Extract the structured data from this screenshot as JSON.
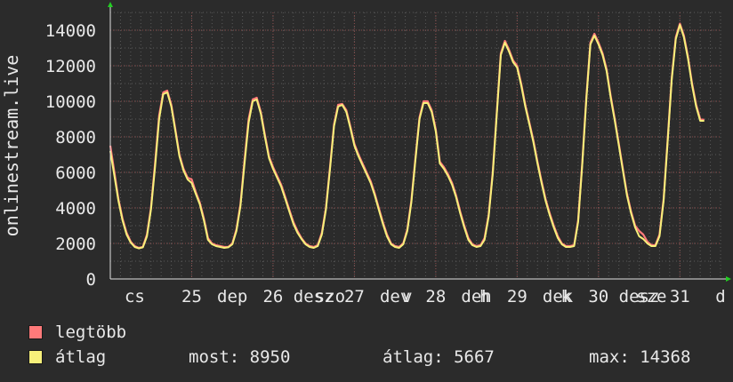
{
  "chart_data": {
    "type": "line",
    "ylabel": "onlinestream.live",
    "ylim": [
      0,
      15000
    ],
    "yticks": [
      0,
      2000,
      4000,
      6000,
      8000,
      10000,
      12000,
      14000
    ],
    "xtick_labels": [
      {
        "pos": 0.3,
        "text": "cs"
      },
      {
        "pos": 1,
        "text": "25"
      },
      {
        "pos": 1.5,
        "text": "dep"
      },
      {
        "pos": 2,
        "text": "26"
      },
      {
        "pos": 2.5,
        "text": "desz"
      },
      {
        "pos": 2.7,
        "text": "szo"
      },
      {
        "pos": 3,
        "text": "27"
      },
      {
        "pos": 3.5,
        "text": "dev"
      },
      {
        "pos": 3.65,
        "text": "v"
      },
      {
        "pos": 4,
        "text": "28"
      },
      {
        "pos": 4.5,
        "text": "deh"
      },
      {
        "pos": 4.6,
        "text": "h"
      },
      {
        "pos": 5,
        "text": "29"
      },
      {
        "pos": 5.5,
        "text": "dek"
      },
      {
        "pos": 5.6,
        "text": "k"
      },
      {
        "pos": 6,
        "text": "30"
      },
      {
        "pos": 6.5,
        "text": "desz"
      },
      {
        "pos": 6.65,
        "text": "sze"
      },
      {
        "pos": 7,
        "text": "31"
      },
      {
        "pos": 7.5,
        "text": "d"
      }
    ],
    "grid": true,
    "x": [
      0,
      0.05,
      0.1,
      0.15,
      0.2,
      0.25,
      0.3,
      0.35,
      0.4,
      0.45,
      0.5,
      0.55,
      0.6,
      0.65,
      0.7,
      0.75,
      0.8,
      0.85,
      0.9,
      0.95,
      1.0,
      1.05,
      1.1,
      1.15,
      1.2,
      1.25,
      1.3,
      1.35,
      1.4,
      1.45,
      1.5,
      1.55,
      1.6,
      1.65,
      1.7,
      1.75,
      1.8,
      1.85,
      1.9,
      1.95,
      2.0,
      2.05,
      2.1,
      2.15,
      2.2,
      2.25,
      2.3,
      2.35,
      2.4,
      2.45,
      2.5,
      2.55,
      2.6,
      2.65,
      2.7,
      2.75,
      2.8,
      2.85,
      2.9,
      2.95,
      3.0,
      3.05,
      3.1,
      3.15,
      3.2,
      3.25,
      3.3,
      3.35,
      3.4,
      3.45,
      3.5,
      3.55,
      3.6,
      3.65,
      3.7,
      3.75,
      3.8,
      3.85,
      3.9,
      3.95,
      4.0,
      4.05,
      4.1,
      4.15,
      4.2,
      4.25,
      4.3,
      4.35,
      4.4,
      4.45,
      4.5,
      4.55,
      4.6,
      4.65,
      4.7,
      4.75,
      4.8,
      4.85,
      4.9,
      4.95,
      5.0,
      5.05,
      5.1,
      5.15,
      5.2,
      5.25,
      5.3,
      5.35,
      5.4,
      5.45,
      5.5,
      5.55,
      5.6,
      5.65,
      5.7,
      5.75,
      5.8,
      5.85,
      5.9,
      5.95,
      6.0,
      6.05,
      6.1,
      6.15,
      6.2,
      6.25,
      6.3,
      6.35,
      6.4,
      6.45,
      6.5,
      6.55,
      6.6,
      6.65,
      6.7,
      6.75,
      6.8,
      6.85,
      6.9,
      6.95,
      7.0,
      7.05,
      7.1,
      7.15,
      7.2,
      7.25,
      7.3,
      7.35,
      7.4,
      7.45,
      7.5
    ],
    "series": [
      {
        "name": "legtöbb",
        "color": "#ff7a7a",
        "values": [
          7500,
          6000,
          4500,
          3400,
          2600,
          2100,
          1850,
          1750,
          1800,
          2500,
          4000,
          6500,
          9200,
          10500,
          10600,
          9800,
          8400,
          7000,
          6200,
          5700,
          5600,
          4900,
          4300,
          3400,
          2300,
          2000,
          1900,
          1850,
          1800,
          1800,
          2000,
          2800,
          4200,
          6700,
          9000,
          10100,
          10200,
          9400,
          8100,
          6900,
          6300,
          5800,
          5300,
          4600,
          3900,
          3200,
          2700,
          2300,
          2000,
          1850,
          1800,
          1900,
          2600,
          4000,
          6300,
          8700,
          9800,
          9850,
          9500,
          8600,
          7600,
          7000,
          6500,
          6000,
          5500,
          4800,
          4000,
          3200,
          2500,
          2000,
          1850,
          1800,
          2000,
          2800,
          4400,
          6800,
          9100,
          10000,
          10000,
          9500,
          8400,
          6600,
          6300,
          5900,
          5400,
          4700,
          3800,
          3000,
          2300,
          1950,
          1850,
          1900,
          2300,
          3600,
          6000,
          9400,
          12700,
          13400,
          12900,
          12300,
          12000,
          11000,
          9800,
          8800,
          7800,
          6600,
          5500,
          4500,
          3700,
          3000,
          2400,
          2000,
          1850,
          1850,
          1900,
          3300,
          6500,
          10200,
          13300,
          13800,
          13300,
          12700,
          11800,
          10300,
          9000,
          7600,
          6200,
          4800,
          3800,
          3000,
          2700,
          2500,
          2100,
          1900,
          1900,
          2500,
          4500,
          7800,
          11300,
          13600,
          14368,
          13700,
          12500,
          11000,
          9800,
          9000,
          8950
        ]
      },
      {
        "name": "átlag",
        "color": "#f7f07a",
        "values": [
          7200,
          5800,
          4400,
          3300,
          2500,
          2050,
          1800,
          1720,
          1780,
          2400,
          3900,
          6300,
          9000,
          10400,
          10500,
          9700,
          8300,
          6900,
          6100,
          5600,
          5400,
          4800,
          4200,
          3300,
          2200,
          1950,
          1850,
          1800,
          1750,
          1780,
          1950,
          2700,
          4100,
          6500,
          8800,
          10000,
          10100,
          9300,
          8000,
          6800,
          6200,
          5700,
          5200,
          4500,
          3800,
          3100,
          2600,
          2250,
          1950,
          1800,
          1750,
          1850,
          2500,
          3900,
          6200,
          8600,
          9700,
          9800,
          9400,
          8500,
          7500,
          6900,
          6400,
          5900,
          5400,
          4700,
          3900,
          3100,
          2400,
          1950,
          1800,
          1750,
          1950,
          2700,
          4300,
          6700,
          9000,
          9900,
          9900,
          9400,
          8300,
          6500,
          6200,
          5800,
          5300,
          4600,
          3700,
          2900,
          2200,
          1900,
          1800,
          1850,
          2200,
          3500,
          5900,
          9300,
          12600,
          13300,
          12800,
          12200,
          11900,
          10900,
          9700,
          8700,
          7700,
          6500,
          5400,
          4400,
          3600,
          2900,
          2300,
          1950,
          1800,
          1800,
          1850,
          3200,
          6400,
          10100,
          13200,
          13700,
          13200,
          12600,
          11700,
          10200,
          8900,
          7500,
          6100,
          4700,
          3700,
          2900,
          2400,
          2250,
          2000,
          1850,
          1850,
          2400,
          4400,
          7700,
          11200,
          13500,
          14300,
          13600,
          12400,
          10900,
          9700,
          8900,
          8900
        ]
      }
    ]
  },
  "legend": [
    {
      "label": "legtöbb",
      "color": "#ff7a7a"
    },
    {
      "label": "átlag",
      "color": "#f7f07a"
    }
  ],
  "stats": {
    "now": "most: 8950",
    "avg": "átlag: 5667",
    "max": "max: 14368"
  }
}
